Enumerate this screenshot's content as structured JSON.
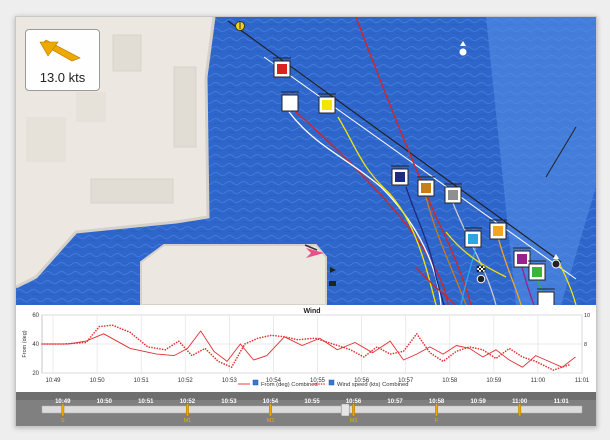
{
  "wind": {
    "speed_label": "13.0 kts",
    "arrow_color": "#f0a800"
  },
  "colors": {
    "water": "#2f66cc",
    "land": "#ece8e1",
    "flags": [
      "#d8231e",
      "#ffffff",
      "#f3e500",
      "#1e2a80",
      "#c97c1a",
      "#8f8f8f",
      "#2ba6e3",
      "#f4a520",
      "#9b1f8d",
      "#3cb43c"
    ]
  },
  "chart_data": {
    "type": "line",
    "title": "Wind",
    "ylabel": "From (deg)",
    "ylim": [
      20,
      60
    ],
    "y_ticks": [
      {
        "value": 60,
        "label": "60"
      },
      {
        "value": 40,
        "label": "40"
      },
      {
        "value": 20,
        "label": "20"
      }
    ],
    "right_ticks": [
      "10",
      "8"
    ],
    "x_labels": [
      "10:49",
      "10:50",
      "10:51",
      "10:52",
      "10:53",
      "10:54",
      "10:55",
      "10:56",
      "10:57",
      "10:58",
      "10:59",
      "11:00",
      "11:01"
    ],
    "x_range": [
      0,
      12.25
    ],
    "series": [
      {
        "name": "From (deg) Combined",
        "style": "solid",
        "color": "#e03030",
        "x": [
          0,
          0.6,
          1.0,
          1.4,
          2.0,
          2.6,
          3.0,
          3.3,
          3.6,
          3.9,
          4.2,
          4.5,
          4.8,
          5.1,
          5.5,
          5.9,
          6.3,
          6.7,
          7.1,
          7.5,
          7.9,
          8.2,
          8.5,
          8.8,
          9.1,
          9.4,
          9.7,
          10.0,
          10.3,
          10.6,
          10.9,
          11.2,
          11.5,
          11.8,
          12.1
        ],
        "values": [
          40,
          40,
          42,
          47,
          37,
          33,
          32,
          37,
          49,
          35,
          28,
          40,
          29,
          32,
          45,
          39,
          44,
          36,
          41,
          34,
          42,
          29,
          33,
          38,
          33,
          39,
          37,
          31,
          36,
          29,
          24,
          32,
          28,
          24,
          31
        ]
      },
      {
        "name": "Wind speed (kts) Combined",
        "style": "dotted",
        "color": "#e03030",
        "x": [
          0,
          0.5,
          1.0,
          1.3,
          1.6,
          2.0,
          2.4,
          2.8,
          3.1,
          3.4,
          3.7,
          4.0,
          4.3,
          4.6,
          4.9,
          5.2,
          5.5,
          5.8,
          6.2,
          6.6,
          7.0,
          7.3,
          7.6,
          7.9,
          8.2,
          8.5,
          8.8,
          9.1,
          9.4,
          9.7,
          10.0,
          10.3,
          10.6,
          10.9,
          11.2,
          11.6,
          12.0
        ],
        "values": [
          40,
          40,
          41,
          52,
          53,
          48,
          38,
          36,
          42,
          32,
          37,
          28,
          24,
          40,
          44,
          46,
          45,
          43,
          44,
          40,
          36,
          31,
          38,
          33,
          35,
          47,
          34,
          28,
          35,
          38,
          36,
          30,
          37,
          31,
          28,
          22,
          26
        ]
      }
    ]
  },
  "timeline": {
    "labels": [
      "10:49",
      "10:50",
      "10:51",
      "10:52",
      "10:53",
      "10:54",
      "10:55",
      "10:56",
      "10:57",
      "10:58",
      "10:59",
      "11:00",
      "11:01"
    ],
    "markers": [
      {
        "time": 0.0,
        "label": "S"
      },
      {
        "time": 3.0,
        "label": "M1"
      },
      {
        "time": 5.0,
        "label": "M2"
      },
      {
        "time": 7.0,
        "label": "M3"
      },
      {
        "time": 9.0,
        "label": "F"
      },
      {
        "time": 11.0,
        "label": ""
      }
    ],
    "cursor_time": 6.8
  }
}
